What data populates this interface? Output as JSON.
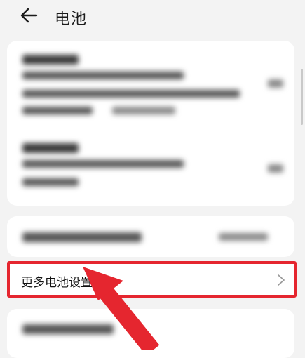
{
  "header": {
    "title": "电池",
    "back_icon": "back-arrow-icon"
  },
  "rows": {
    "more_battery_settings": {
      "label": "更多电池设置"
    }
  },
  "annotation": {
    "color": "#e5262f",
    "arrow_icon": "pointer-arrow"
  }
}
